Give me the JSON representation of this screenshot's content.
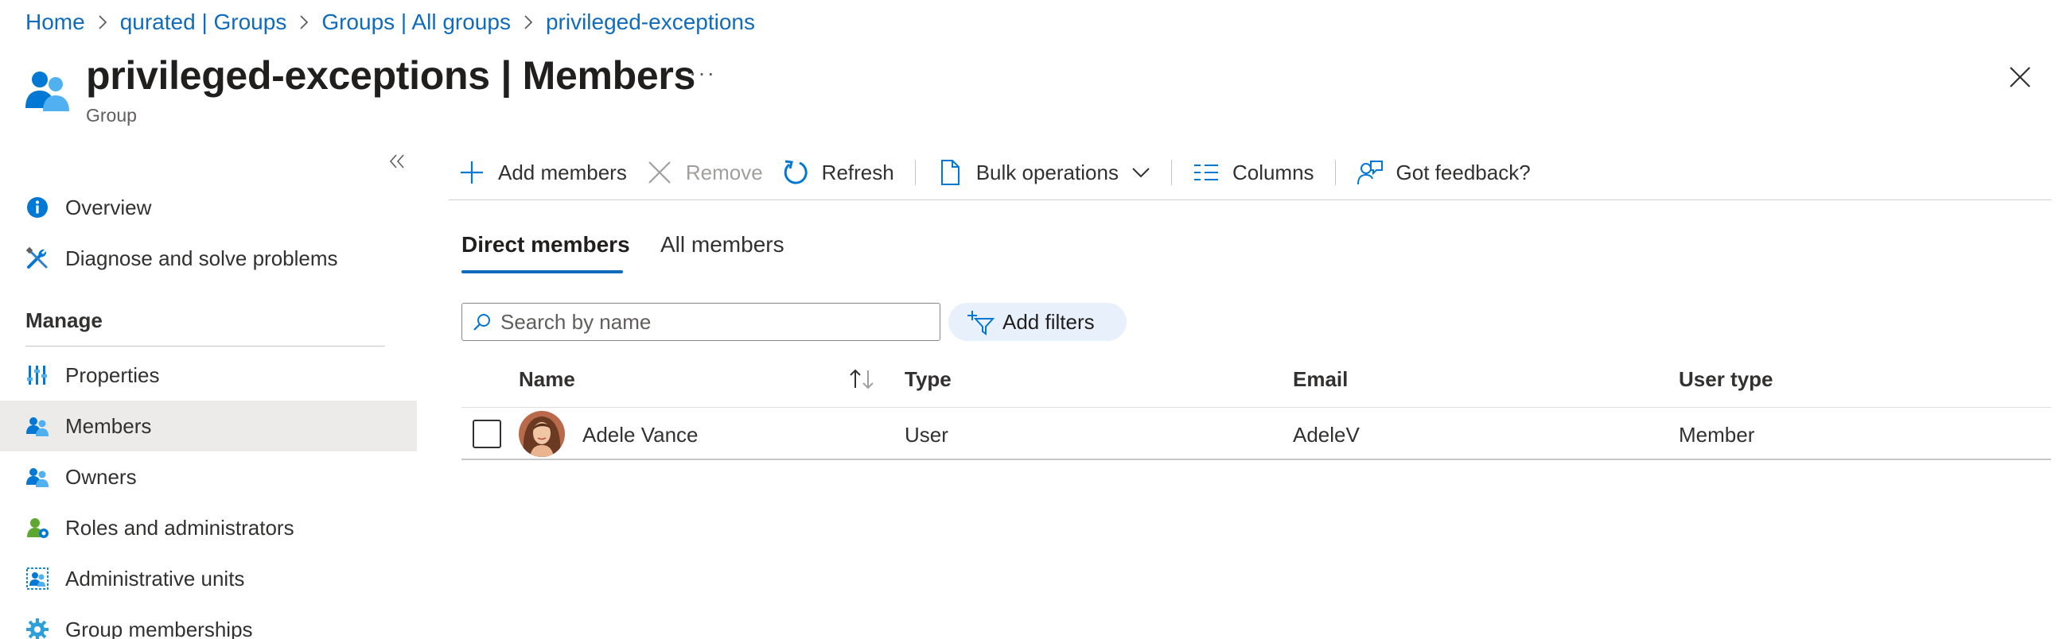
{
  "breadcrumb": [
    "Home",
    "qurated | Groups",
    "Groups | All groups",
    "privileged-exceptions"
  ],
  "header": {
    "title_name": "privileged-exceptions",
    "title_suffix": " | Members",
    "subtitle": "Group",
    "more": "···"
  },
  "sidebar": {
    "items_top": [
      {
        "label": "Overview",
        "icon": "info-icon"
      },
      {
        "label": "Diagnose and solve problems",
        "icon": "wrench-icon"
      }
    ],
    "section_title": "Manage",
    "items_manage": [
      {
        "label": "Properties",
        "icon": "properties-icon"
      },
      {
        "label": "Members",
        "icon": "members-icon",
        "selected": true
      },
      {
        "label": "Owners",
        "icon": "owners-icon"
      },
      {
        "label": "Roles and administrators",
        "icon": "roles-icon"
      },
      {
        "label": "Administrative units",
        "icon": "admin-units-icon"
      },
      {
        "label": "Group memberships",
        "icon": "gear-icon"
      }
    ]
  },
  "toolbar": {
    "add_members": "Add members",
    "remove": "Remove",
    "refresh": "Refresh",
    "bulk_operations": "Bulk operations",
    "columns": "Columns",
    "feedback": "Got feedback?"
  },
  "tabs": {
    "direct": "Direct members",
    "all": "All members"
  },
  "search": {
    "placeholder": "Search by name",
    "value": ""
  },
  "filters": {
    "label": "Add filters"
  },
  "table": {
    "columns": [
      "Name",
      "Type",
      "Email",
      "User type"
    ],
    "rows": [
      {
        "name": "Adele Vance",
        "type": "User",
        "email": "AdeleV",
        "user_type": "Member"
      }
    ]
  },
  "colors": {
    "accent": "#0f6cbd",
    "selected_bg": "#edebe9",
    "filter_pill_bg": "#e8f1fb"
  }
}
